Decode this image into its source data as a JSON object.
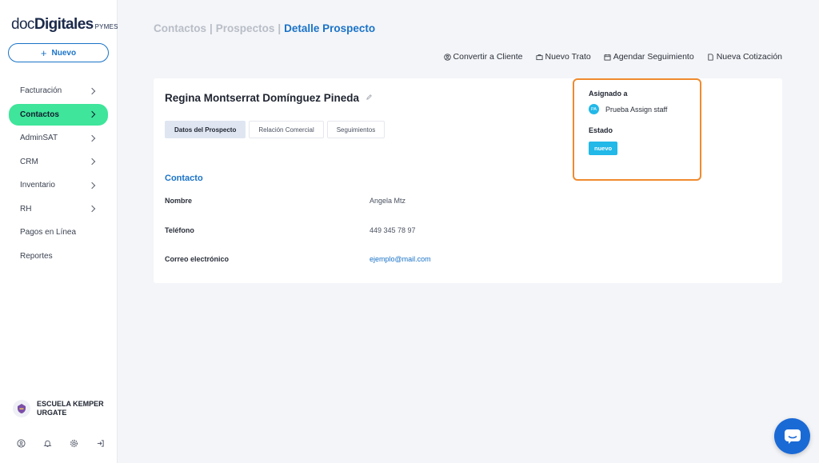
{
  "brand": {
    "name_light": "doc",
    "name_bold": "Digitales",
    "suffix": "PYMES"
  },
  "sidebar": {
    "new_button_label": "Nuevo",
    "items": [
      {
        "label": "Facturación",
        "has_chevron": true,
        "active": false
      },
      {
        "label": "Contactos",
        "has_chevron": true,
        "active": true
      },
      {
        "label": "AdminSAT",
        "has_chevron": true,
        "active": false
      },
      {
        "label": "CRM",
        "has_chevron": true,
        "active": false
      },
      {
        "label": "Inventario",
        "has_chevron": true,
        "active": false
      },
      {
        "label": "RH",
        "has_chevron": true,
        "active": false
      },
      {
        "label": "Pagos en Línea",
        "has_chevron": false,
        "active": false
      },
      {
        "label": "Reportes",
        "has_chevron": false,
        "active": false
      }
    ],
    "account_name": "ESCUELA KEMPER URGATE",
    "bottom_icons": [
      "help-icon",
      "bell-icon",
      "gear-icon",
      "logout-icon"
    ]
  },
  "breadcrumb": {
    "items": [
      "Contactos",
      "Prospectos"
    ],
    "separator": "|",
    "current": "Detalle Prospecto"
  },
  "actions": {
    "convert": "Convertir a Cliente",
    "new_deal": "Nuevo Trato",
    "schedule": "Agendar Seguimiento",
    "new_quote": "Nueva Cotización"
  },
  "prospect": {
    "name": "Regina Montserrat Domínguez Pineda",
    "tabs": [
      "Datos del Prospecto",
      "Relación Comercial",
      "Seguimientos"
    ],
    "active_tab": 0,
    "section_title": "Contacto",
    "fields": [
      {
        "label": "Nombre",
        "value": "Angela Mtz"
      },
      {
        "label": "Teléfono",
        "value": "449 345 78 97"
      },
      {
        "label": "Correo electrónico",
        "value": "ejemplo@mail.com"
      }
    ]
  },
  "assignment": {
    "assigned_label": "Asignado a",
    "staff_initials": "PA",
    "staff_name": "Prueba Assign staff",
    "status_label": "Estado",
    "status_value": "nuevo"
  },
  "colors": {
    "accent": "#1a73c8",
    "active_nav": "#3ee59a",
    "highlight_border": "#f08a2e",
    "status_badge": "#22b8e8",
    "chat_button": "#1a6ad6"
  }
}
